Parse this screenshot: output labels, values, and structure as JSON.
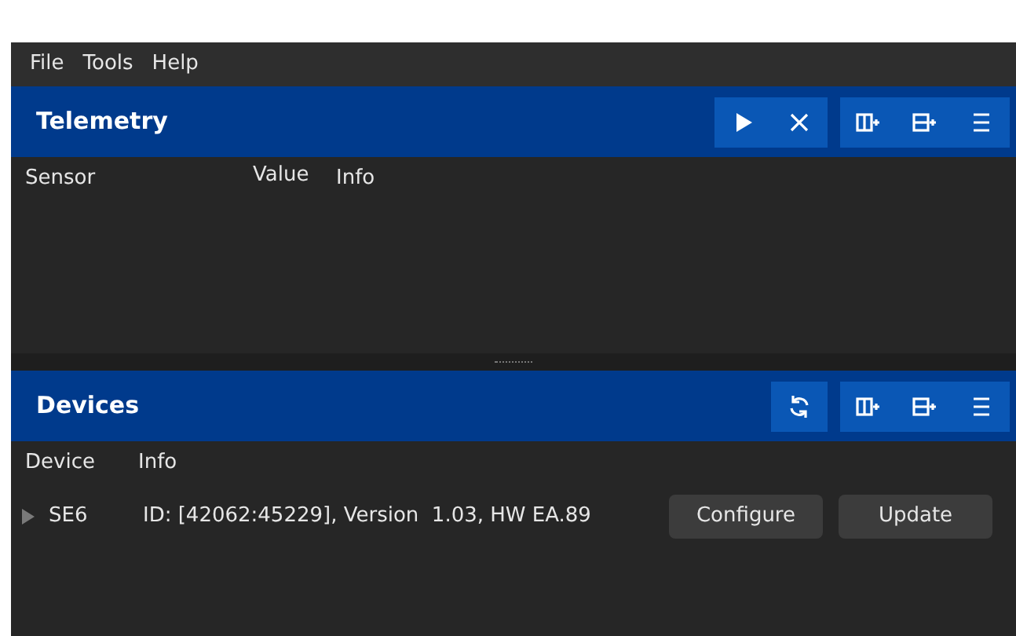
{
  "menu": [
    "File",
    "Tools",
    "Help"
  ],
  "telemetry": {
    "title": "Telemetry",
    "columns": [
      "Sensor",
      "Value",
      "Info"
    ]
  },
  "devices": {
    "title": "Devices",
    "columns": [
      "Device",
      "Info"
    ],
    "rows": [
      {
        "name": "SE6",
        "info": "ID: [42062:45229], Version  1.03, HW EA.89",
        "expanded": false,
        "buttons": [
          "Configure",
          "Update"
        ]
      }
    ]
  }
}
